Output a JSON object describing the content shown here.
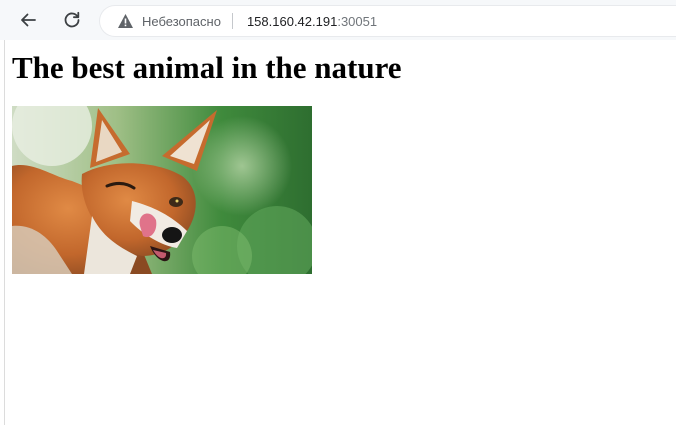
{
  "browser": {
    "security_label": "Небезопасно",
    "url_host": "158.160.42.191",
    "url_port": ":30051",
    "icons": {
      "back": "arrow-left-icon",
      "reload": "reload-icon",
      "security": "warning-triangle-icon"
    }
  },
  "page": {
    "heading": "The best animal in the nature",
    "image_alt": "fox"
  },
  "colors": {
    "toolbar_bg": "#f6f8fa",
    "fox_fur": "#c8692a",
    "background_green": "#4f8f45"
  }
}
